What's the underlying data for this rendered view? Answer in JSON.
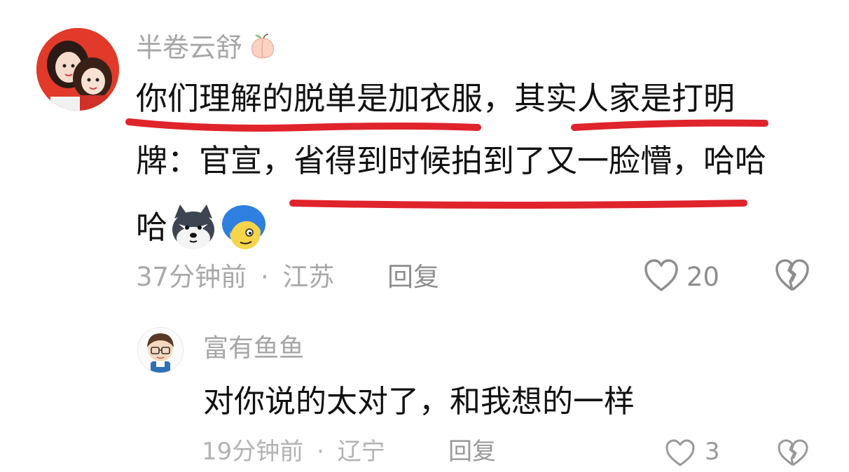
{
  "comments": [
    {
      "username": "半卷云舒",
      "username_badge_icon": "peach-icon",
      "text_line1": "你们理解的脱单是加衣服，其实人家是打明",
      "text_line2": "牌：官宣，省得到时候拍到了又一脸懵，哈哈",
      "text_line3": "哈",
      "emojis": [
        "husky-dog-emoji",
        "blue-hair-smirk-emoji"
      ],
      "time": "37分钟前",
      "separator": "·",
      "location": "江苏",
      "reply_label": "回复",
      "like_count": "20",
      "highlight_color": "#e0242c"
    },
    {
      "username": "富有鱼鱼",
      "text": "对你说的太对了，和我想的一样",
      "time": "19分钟前",
      "separator": "·",
      "location": "辽宁",
      "reply_label": "回复",
      "like_count": "3"
    }
  ],
  "colors": {
    "username": "#a6a6a6",
    "meta": "#a9a9a9",
    "underline": "#e0242c"
  }
}
